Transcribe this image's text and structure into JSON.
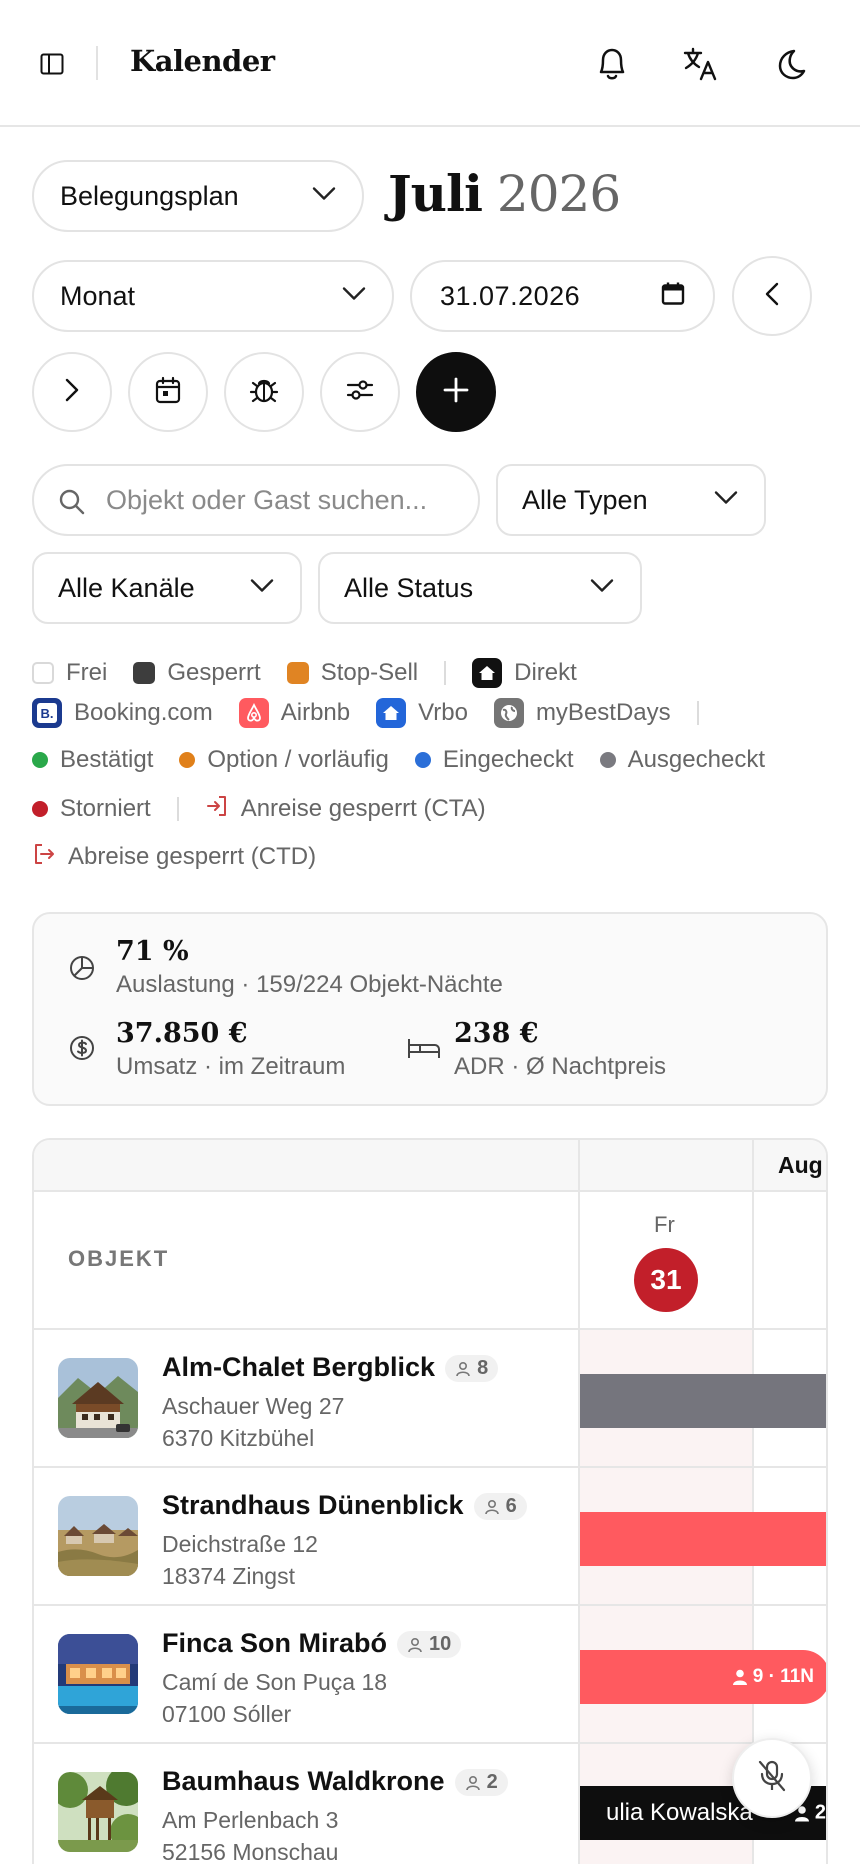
{
  "header": {
    "title": "Kalender",
    "icons": [
      "sidebar-toggle-icon",
      "bell-icon",
      "translate-icon",
      "moon-icon"
    ]
  },
  "toolbar": {
    "view_select": "Belegungsplan",
    "month": "Juli",
    "year": "2026",
    "range_select": "Monat",
    "date_value": "31.07.2026",
    "search_placeholder": "Objekt oder Gast suchen...",
    "type_filter": "Alle Typen",
    "channel_filter": "Alle Kanäle",
    "status_filter": "Alle Status"
  },
  "legend": {
    "availability": [
      {
        "label": "Frei",
        "color": "#ffffff"
      },
      {
        "label": "Gesperrt",
        "color": "#3d3d3d"
      },
      {
        "label": "Stop-Sell",
        "color": "#e08423"
      }
    ],
    "channels": [
      {
        "label": "Direkt",
        "color": "#111111",
        "icon": "home-icon"
      },
      {
        "label": "Booking.com",
        "color": "#1b3a8f",
        "icon": "booking-icon"
      },
      {
        "label": "Airbnb",
        "color": "#ff5a5f",
        "icon": "airbnb-icon"
      },
      {
        "label": "Vrbo",
        "color": "#2366d9",
        "icon": "vrbo-icon"
      },
      {
        "label": "myBestDays",
        "color": "#757575",
        "icon": "globe-icon"
      }
    ],
    "status": [
      {
        "label": "Bestätigt",
        "color": "#2aa84a"
      },
      {
        "label": "Option / vorläufig",
        "color": "#e0801a"
      },
      {
        "label": "Eingecheckt",
        "color": "#2b6fd8"
      },
      {
        "label": "Ausgecheckt",
        "color": "#7a7a80"
      },
      {
        "label": "Storniert",
        "color": "#c21f2a"
      }
    ],
    "restrictions": [
      {
        "label": "Anreise gesperrt (CTA)",
        "icon": "login-icon"
      },
      {
        "label": "Abreise gesperrt (CTD)",
        "icon": "logout-icon"
      }
    ]
  },
  "stats": {
    "occupancy": {
      "value": "71 %",
      "label": "Auslastung · 159/224 Objekt-Nächte"
    },
    "revenue": {
      "value": "37.850 €",
      "label": "Umsatz · im Zeitraum"
    },
    "adr": {
      "value": "238 €",
      "label": "ADR · Ø Nachtpreis"
    }
  },
  "calendar": {
    "next_month_label": "Aug",
    "object_header": "OBJEKT",
    "day_of_week": "Fr",
    "day_number": "31",
    "properties": [
      {
        "name": "Alm-Chalet Bergblick",
        "guests": "8",
        "street": "Aschauer Weg 27",
        "city": "6370 Kitzbühel",
        "booking": {
          "status_color": "#75757d",
          "label": ""
        }
      },
      {
        "name": "Strandhaus Dünenblick",
        "guests": "6",
        "street": "Deichstraße 12",
        "city": "18374 Zingst",
        "booking": {
          "status_color": "#ff5a5f",
          "label": ""
        }
      },
      {
        "name": "Finca Son Mirabó",
        "guests": "10",
        "street": "Camí de Son Puça 18",
        "city": "07100 Sóller",
        "booking": {
          "status_color": "#ff5a5f",
          "label": "9 · 11N"
        }
      },
      {
        "name": "Baumhaus Waldkrone",
        "guests": "2",
        "street": "Am Perlenbach 3",
        "city": "52156 Monschau",
        "booking": {
          "status_color": "#0e0e0e",
          "label": "ulia Kowalska",
          "guests": "2"
        }
      }
    ]
  }
}
